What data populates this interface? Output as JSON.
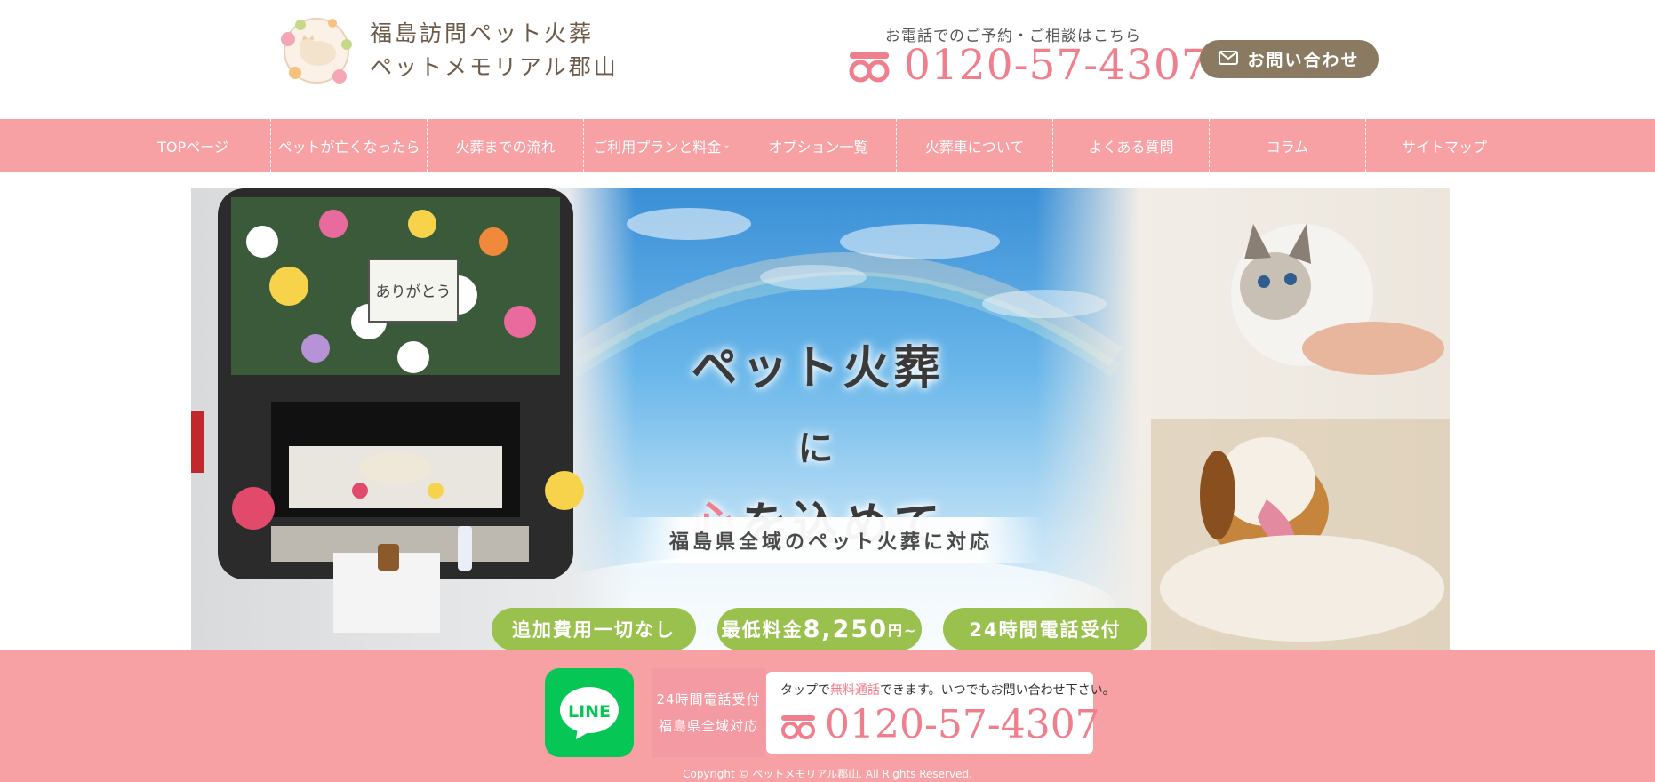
{
  "header": {
    "logo_line1": "福島訪問ペット火葬",
    "logo_line2": "ペットメモリアル郡山",
    "contact_caption": "お電話でのご予約・ご相談はこちら",
    "phone": "0120-57-4307",
    "inquiry_label": "お問い合わせ"
  },
  "nav": {
    "items": [
      {
        "label": "TOPページ"
      },
      {
        "label": "ペットが亡くなったら"
      },
      {
        "label": "火葬までの流れ"
      },
      {
        "label": "ご利用プランと料金"
      },
      {
        "label": "オプション一覧"
      },
      {
        "label": "火葬車について"
      },
      {
        "label": "よくある質問"
      },
      {
        "label": "コラム"
      },
      {
        "label": "サイトマップ"
      }
    ]
  },
  "hero": {
    "title_line1_main": "ペット火葬",
    "title_line1_tail": "に",
    "title_line2_accent": "心",
    "title_line2_rest": "を込めて",
    "subtitle": "福島県全域のペット火葬に対応",
    "van_sign": "ありがとう",
    "badges": {
      "b1": "追加費用一切なし",
      "b2_pre": "最低料金",
      "b2_price": "8,250",
      "b2_unit": "円~",
      "b3": "24時間電話受付"
    }
  },
  "footer": {
    "line_label": "LINE",
    "info_line1": "24時間電話受付",
    "info_line2": "福島県全域対応",
    "tel_caption_pre": "タップで",
    "tel_caption_highlight": "無料通話",
    "tel_caption_post": "できます。いつでもお問い合わせ下さい。",
    "phone": "0120-57-4307",
    "copyright": "Copyright © ペットメモリアル郡山. All Rights Reserved."
  },
  "colors": {
    "brand_pink": "#f7a1a5",
    "phone_pink": "#f07f8e",
    "badge_green": "#9ac04d",
    "button_brown": "#8a7a62",
    "line_green": "#06c755"
  },
  "icons": [
    "flower-cat-logo-icon",
    "freedial-icon",
    "mail-icon",
    "line-icon",
    "chevron-down-icon"
  ]
}
